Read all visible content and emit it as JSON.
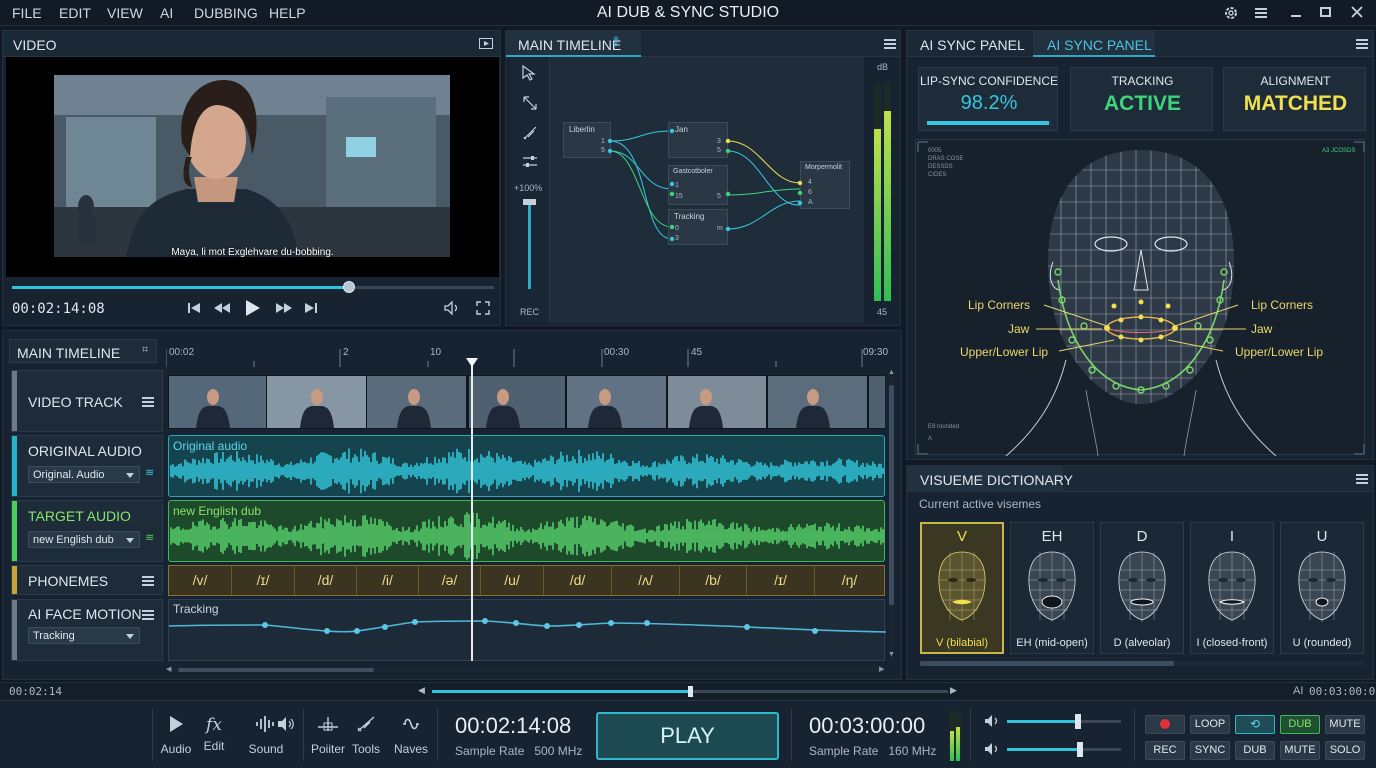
{
  "app": {
    "title": "AI DUB & SYNC STUDIO",
    "menu": [
      "FILE",
      "EDIT",
      "VIEW",
      "AI",
      "DUBBING",
      "HELP"
    ]
  },
  "video": {
    "title": "VIDEO",
    "subtitle": "Maya, li mot Exglehvare du-bobbing.",
    "time": "00:02:14:08",
    "progress": 0.7
  },
  "node_timeline": {
    "title": "MAIN TIMELINE",
    "zoom": "+100%",
    "rec": "REC",
    "db_label": "dB",
    "db_value": "45",
    "nodes": [
      {
        "title": "Liberlin",
        "ports": [
          "1",
          "5"
        ]
      },
      {
        "title": "Jan",
        "ports": [
          "3",
          "5"
        ]
      },
      {
        "title": "Gastcotboler",
        "ports": [
          "1",
          "15",
          "5"
        ]
      },
      {
        "title": "Tracking",
        "ports": [
          "0",
          "3",
          "m"
        ]
      },
      {
        "title": "Morpermolit",
        "ports": [
          "4",
          "6",
          "A"
        ]
      }
    ]
  },
  "sync_panel": {
    "tabs": [
      "AI SYNC PANEL",
      "AI SYNC PANEL"
    ],
    "stats": [
      {
        "label": "LIP-SYNC CONFIDENCE",
        "value": "98.2%",
        "color": "#35c6de",
        "level": 0.982
      },
      {
        "label": "TRACKING",
        "value": "ACTIVE",
        "color": "#3fd47a"
      },
      {
        "label": "ALIGNMENT",
        "value": "MATCHED",
        "color": "#f2df4f"
      }
    ],
    "small_text_left": [
      "0005",
      "DRAS COSE",
      "DESSDS",
      "CIDES"
    ],
    "small_text_right": "A3 JCOSDS",
    "small_bottom": [
      "E9 rounded",
      "A"
    ],
    "labels_left": [
      "Lip Corners",
      "Jaw",
      "Upper/Lower Lip"
    ],
    "labels_right": [
      "Lip Corners",
      "Jaw",
      "Upper/Lower Lip"
    ]
  },
  "main_timeline": {
    "title": "MAIN TIMELINE",
    "ruler": [
      "00:02",
      "2",
      "10",
      "00:30",
      "45",
      "09:30"
    ],
    "tracks": {
      "video": "VIDEO TRACK",
      "original": {
        "label": "ORIGINAL AUDIO",
        "select": "Original. Audio",
        "wave_label": "Original audio"
      },
      "target": {
        "label": "TARGET AUDIO",
        "select": "new English dub",
        "wave_label": "new English dub"
      },
      "phonemes": {
        "label": "PHONEMES",
        "items": [
          "/v/",
          "/ɪ/",
          "/d/",
          "/i/",
          "/ə/",
          "/u/",
          "/d/",
          "/ʌ/",
          "/b/",
          "/ɪ/",
          "/ŋ/"
        ]
      },
      "face": {
        "label": "AI FACE MOTION",
        "select": "Tracking",
        "curve_label": "Tracking"
      }
    }
  },
  "visemes": {
    "title": "VISUEME DICTIONARY",
    "subtitle": "Current active visemes",
    "items": [
      {
        "letter": "V",
        "caption": "V (bilabial)",
        "active": true
      },
      {
        "letter": "EH",
        "caption": "EH (mid-open)"
      },
      {
        "letter": "D",
        "caption": "D (alveolar)"
      },
      {
        "letter": "I",
        "caption": "I (closed-front)"
      },
      {
        "letter": "U",
        "caption": "U (rounded)"
      }
    ]
  },
  "status": {
    "left": "00:02:14",
    "right_tag": "AI",
    "right": "00:03:00:00",
    "scroll": 0.5
  },
  "transport": {
    "tools": [
      "Audio",
      "Edit",
      "Sound",
      "Poiiter",
      "Tools",
      "Naves"
    ],
    "time1": "00:02:14:08",
    "rate1": "Sample Rate   500 MHz",
    "play": "PLAY",
    "time2": "00:03:00:00",
    "rate2": "Sample Rate   160 MHz",
    "vol1": 0.62,
    "vol2": 0.64,
    "buttons_top": [
      "",
      "LOOP",
      "",
      "DUB",
      "MUTE"
    ],
    "buttons_bottom": [
      "REC",
      "SYNC",
      "DUB",
      "MUTE",
      "SOLO"
    ]
  }
}
